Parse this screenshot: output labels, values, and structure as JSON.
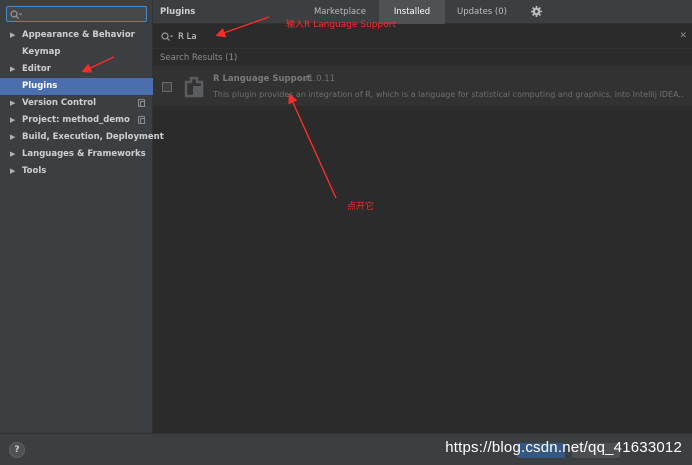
{
  "sidebar": {
    "search_placeholder": "",
    "items": [
      {
        "label": "Appearance & Behavior",
        "expandable": true
      },
      {
        "label": "Keymap",
        "expandable": false
      },
      {
        "label": "Editor",
        "expandable": true
      },
      {
        "label": "Plugins",
        "expandable": false,
        "selected": true
      },
      {
        "label": "Version Control",
        "expandable": true
      },
      {
        "label": "Project: method_demo",
        "expandable": true
      },
      {
        "label": "Build, Execution, Deployment",
        "expandable": true
      },
      {
        "label": "Languages & Frameworks",
        "expandable": true
      },
      {
        "label": "Tools",
        "expandable": true
      }
    ]
  },
  "header": {
    "title": "Plugins",
    "tabs": [
      "Marketplace",
      "Installed",
      "Updates (0)"
    ],
    "active_tab": "Installed"
  },
  "search": {
    "value": "R La"
  },
  "results": {
    "label": "Search Results (1)",
    "plugin": {
      "name": "R Language Support",
      "version": "v1.0.11",
      "description": "This plugin provides an integration of R, which is a language for statistical computing and graphics, into Intellij IDEA...."
    }
  },
  "footer": {
    "help": "?",
    "watermark": "https://blog.csdn.net/qq_41633012"
  },
  "annotations": {
    "search_hint": "输入R Language Support",
    "open_hint": "点开它"
  },
  "colors": {
    "annotation": "#ff2a2a",
    "selection": "#4b6eaf",
    "panel": "#3c3f41",
    "content": "#2b2b2b"
  }
}
